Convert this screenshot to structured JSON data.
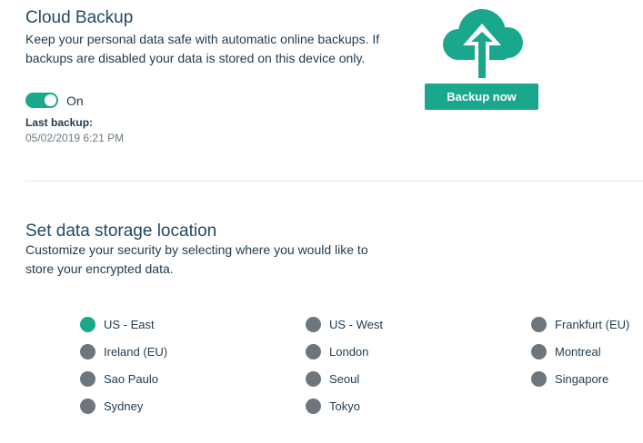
{
  "cloud_backup": {
    "title": "Cloud Backup",
    "description": "Keep your personal data safe with automatic online backups. If backups are disabled your data is stored on this device only.",
    "toggle_state": "On",
    "last_backup_label": "Last backup:",
    "last_backup_value": "05/02/2019 6:21 PM",
    "backup_button_label": "Backup now",
    "cloud_icon": "cloud-upload-icon"
  },
  "storage_location": {
    "title": "Set data storage location",
    "description": "Customize your security by selecting where you would like to store your encrypted data.",
    "selected": "US - East",
    "columns": [
      [
        "US - East",
        "Ireland (EU)",
        "Sao Paulo",
        "Sydney"
      ],
      [
        "US - West",
        "London",
        "Seoul",
        "Tokyo"
      ],
      [
        "Frankfurt (EU)",
        "Montreal",
        "Singapore"
      ]
    ]
  },
  "colors": {
    "accent": "#1aa88c",
    "radio_unselected": "#6d767d",
    "title": "#1f4a63",
    "text": "#1f3b4d",
    "muted": "#6d7a82"
  }
}
